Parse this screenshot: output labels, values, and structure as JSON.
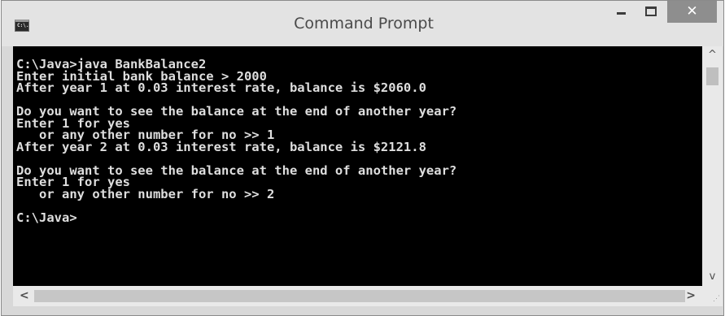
{
  "window": {
    "title": "Command Prompt",
    "icon": "cmd-app-icon",
    "icon_label": "C:\\.",
    "controls": {
      "minimize_icon": "minimize-icon",
      "maximize_icon": "maximize-icon",
      "close_label": "✕"
    }
  },
  "console": {
    "background": "#000000",
    "text_color": "#dedede",
    "lines": [
      "C:\\Java>java BankBalance2",
      "Enter initial bank balance > 2000",
      "After year 1 at 0.03 interest rate, balance is $2060.0",
      "",
      "Do you want to see the balance at the end of another year?",
      "Enter 1 for yes",
      "   or any other number for no >> 1",
      "After year 2 at 0.03 interest rate, balance is $2121.8",
      "",
      "Do you want to see the balance at the end of another year?",
      "Enter 1 for yes",
      "   or any other number for no >> 2",
      "",
      "C:\\Java>"
    ]
  },
  "scrollbars": {
    "up_arrow": "^",
    "down_arrow": "v",
    "left_arrow": "<",
    "right_arrow": ">"
  }
}
